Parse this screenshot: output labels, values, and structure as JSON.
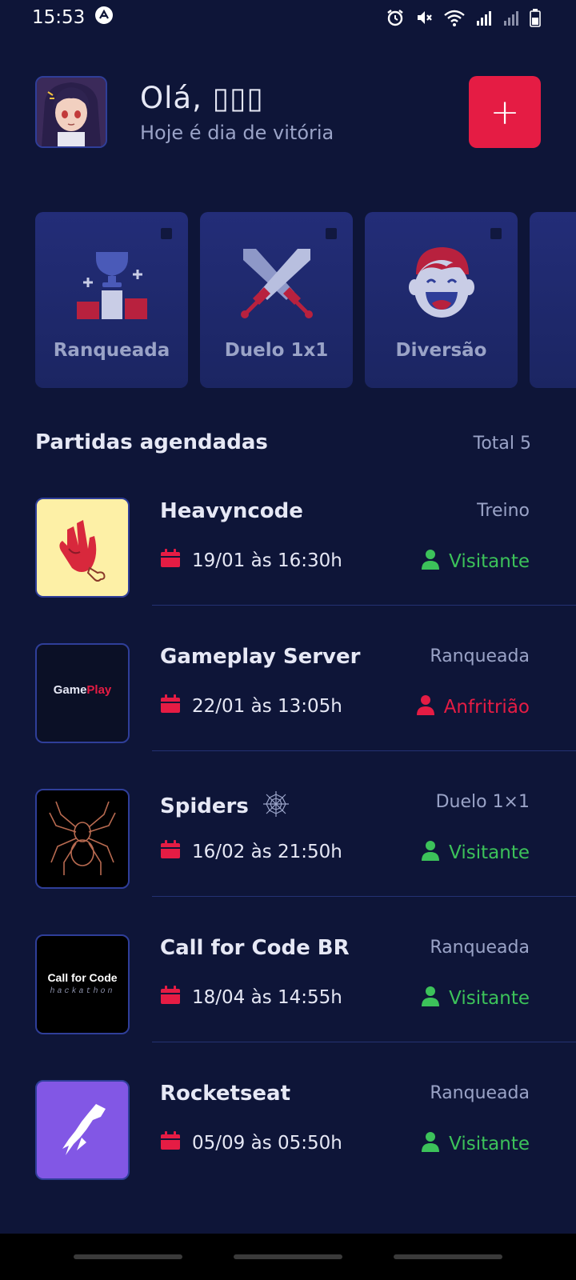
{
  "status": {
    "time": "15:53"
  },
  "header": {
    "greeting": "Olá, ▯▯▯",
    "subtitle": "Hoje é dia de vitória",
    "add_label": "+"
  },
  "categories": [
    {
      "label": "Ranqueada",
      "icon": "podium-trophy-icon"
    },
    {
      "label": "Duelo 1x1",
      "icon": "crossed-swords-icon"
    },
    {
      "label": "Diversão",
      "icon": "laughing-face-icon"
    }
  ],
  "section": {
    "title": "Partidas agendadas",
    "total": "Total 5"
  },
  "matches": [
    {
      "name": "Heavyncode",
      "type": "Treino",
      "date": "19/01 às 16:30h",
      "role": "Visitante"
    },
    {
      "name": "Gameplay Server",
      "type": "Ranqueada",
      "date": "22/01 às 13:05h",
      "role": "Anfritrião",
      "logo_text_a": "Game",
      "logo_text_b": "Play"
    },
    {
      "name": "Spiders",
      "type": "Duelo 1×1",
      "date": "16/02 às 21:50h",
      "role": "Visitante"
    },
    {
      "name": "Call for Code BR",
      "type": "Ranqueada",
      "date": "18/04 às 14:55h",
      "role": "Visitante",
      "logo_text_a": "Call for Code",
      "logo_text_b": "hackathon"
    },
    {
      "name": "Rocketseat",
      "type": "Ranqueada",
      "date": "05/09 às 05:50h",
      "role": "Visitante"
    }
  ],
  "colors": {
    "accent": "#e51c44",
    "visitor": "#3cc25a",
    "background": "#0e1538",
    "card": "#1b2562"
  }
}
